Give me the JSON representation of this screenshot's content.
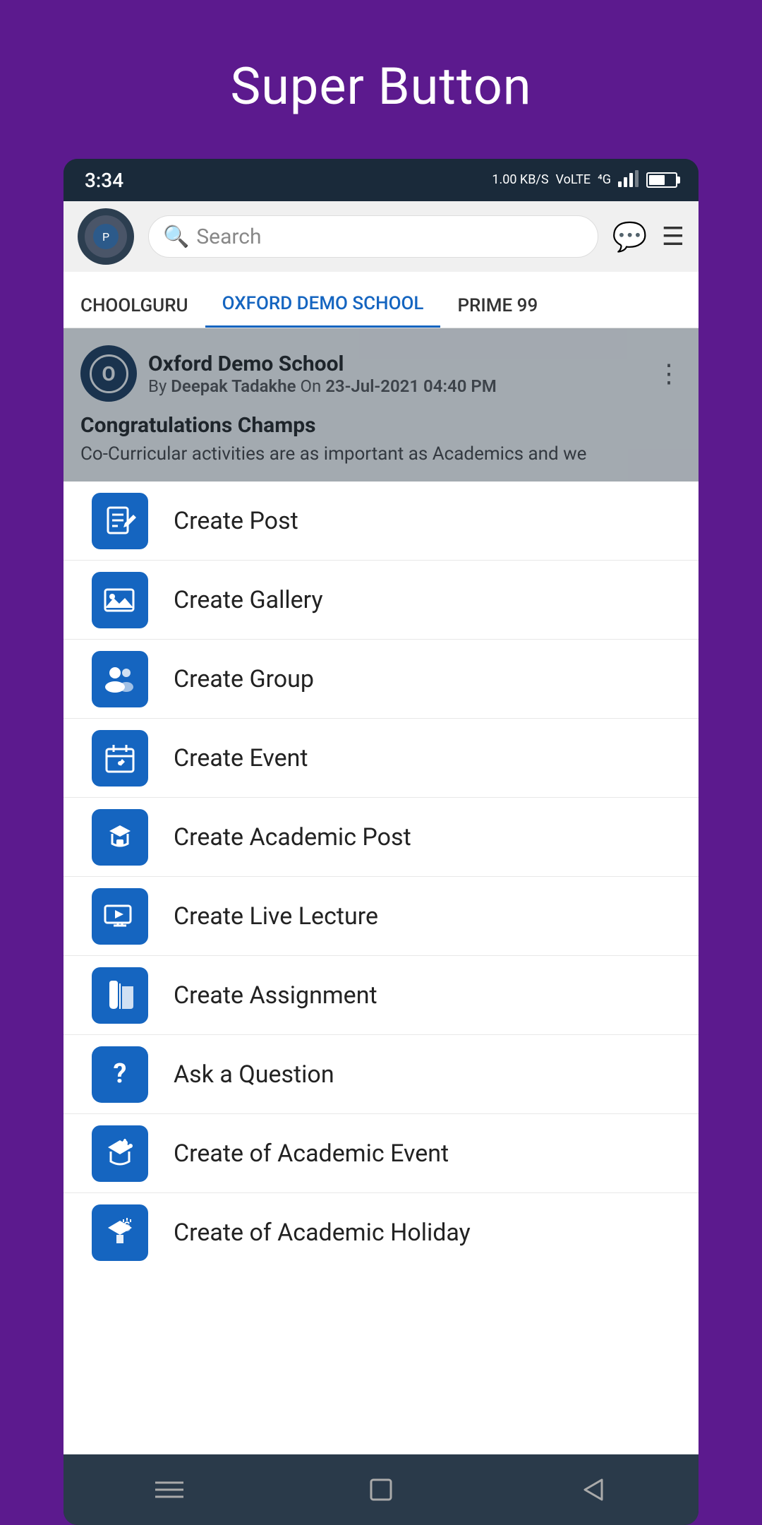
{
  "page": {
    "title": "Super Button"
  },
  "status_bar": {
    "time": "3:34",
    "data_speed": "1.00 KB/S",
    "network": "VoLTE",
    "signal": "4G"
  },
  "header": {
    "search_placeholder": "Search"
  },
  "tabs": [
    {
      "label": "CHOOLGURU",
      "active": false
    },
    {
      "label": "OXFORD DEMO SCHOOL",
      "active": true
    },
    {
      "label": "PRIME 99",
      "active": false
    }
  ],
  "post": {
    "school": "Oxford Demo School",
    "author_prefix": "By",
    "author": "Deepak Tadakhe",
    "date_prefix": "On",
    "date": "23-Jul-2021 04:40 PM",
    "title": "Congratulations Champs",
    "body": "Co-Curricular activities are as important as Academics and we"
  },
  "menu_items": [
    {
      "id": "create-post",
      "label": "Create Post",
      "icon": "📝"
    },
    {
      "id": "create-gallery",
      "label": "Create Gallery",
      "icon": "🖼"
    },
    {
      "id": "create-group",
      "label": "Create Group",
      "icon": "👥"
    },
    {
      "id": "create-event",
      "label": "Create Event",
      "icon": "📅"
    },
    {
      "id": "create-academic-post",
      "label": "Create Academic Post",
      "icon": "🎓"
    },
    {
      "id": "create-live-lecture",
      "label": "Create Live Lecture",
      "icon": "📺"
    },
    {
      "id": "create-assignment",
      "label": "Create Assignment",
      "icon": "📚"
    },
    {
      "id": "ask-question",
      "label": "Ask a Question",
      "icon": "❓"
    },
    {
      "id": "create-academic-event",
      "label": "Create of Academic Event",
      "icon": "🎓"
    },
    {
      "id": "create-academic-holiday",
      "label": "Create of Academic Holiday",
      "icon": "🏝"
    }
  ],
  "bottom_nav": {
    "items": [
      "menu",
      "square",
      "back"
    ]
  },
  "colors": {
    "primary": "#5c1a8e",
    "accent": "#1565c0",
    "header_bg": "#1a2a3a"
  }
}
